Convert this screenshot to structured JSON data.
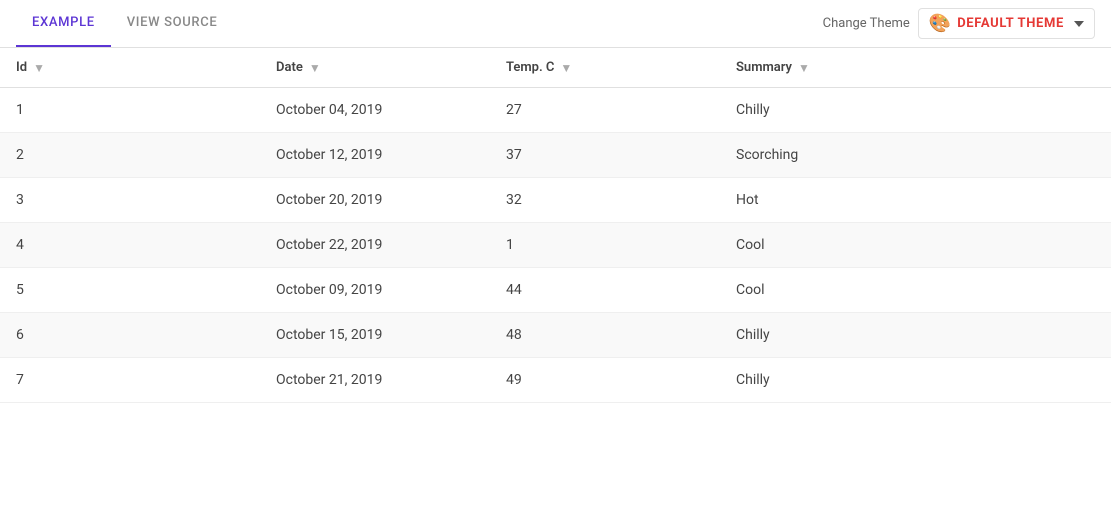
{
  "tabs": {
    "active": "EXAMPLE",
    "items": [
      "EXAMPLE",
      "VIEW SOURCE"
    ]
  },
  "header": {
    "change_theme_label": "Change Theme",
    "theme_label": "DEFAULT THEME",
    "theme_icon": "🎨"
  },
  "table": {
    "columns": [
      {
        "key": "id",
        "label": "Id"
      },
      {
        "key": "date",
        "label": "Date"
      },
      {
        "key": "temp",
        "label": "Temp. C"
      },
      {
        "key": "summary",
        "label": "Summary"
      }
    ],
    "rows": [
      {
        "id": "1",
        "date": "October 04, 2019",
        "temp": "27",
        "summary": "Chilly"
      },
      {
        "id": "2",
        "date": "October 12, 2019",
        "temp": "37",
        "summary": "Scorching"
      },
      {
        "id": "3",
        "date": "October 20, 2019",
        "temp": "32",
        "summary": "Hot"
      },
      {
        "id": "4",
        "date": "October 22, 2019",
        "temp": "1",
        "summary": "Cool"
      },
      {
        "id": "5",
        "date": "October 09, 2019",
        "temp": "44",
        "summary": "Cool"
      },
      {
        "id": "6",
        "date": "October 15, 2019",
        "temp": "48",
        "summary": "Chilly"
      },
      {
        "id": "7",
        "date": "October 21, 2019",
        "temp": "49",
        "summary": "Chilly"
      }
    ]
  }
}
